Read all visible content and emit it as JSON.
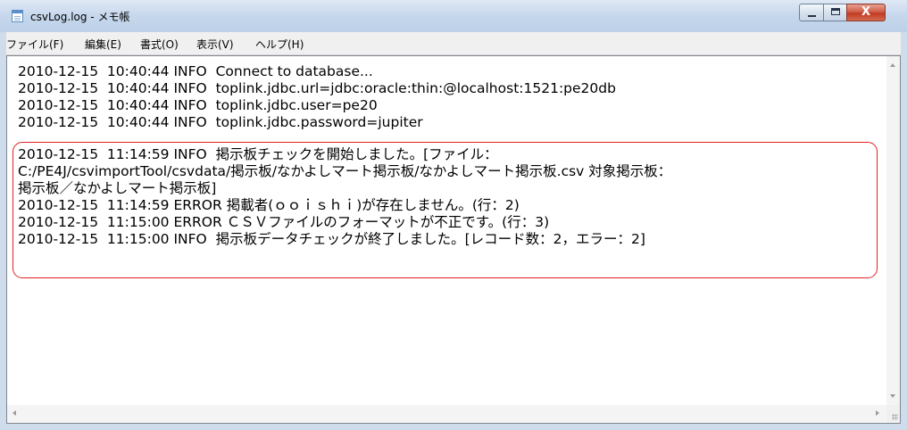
{
  "window": {
    "title": "csvLog.log - メモ帳",
    "close_glyph": "X",
    "icons": [
      "notepad-icon",
      "minimize-icon",
      "maximize-icon",
      "close-icon"
    ]
  },
  "menu": {
    "items": [
      {
        "label": "ファイル(F)"
      },
      {
        "label": "編集(E)"
      },
      {
        "label": "書式(O)"
      },
      {
        "label": "表示(V)"
      },
      {
        "label": "ヘルプ(H)"
      }
    ]
  },
  "document": {
    "lines": [
      "2010-12-15  10:40:44 INFO  Connect to database...",
      "2010-12-15  10:40:44 INFO  toplink.jdbc.url=jdbc:oracle:thin:@localhost:1521:pe20db",
      "2010-12-15  10:40:44 INFO  toplink.jdbc.user=pe20",
      "2010-12-15  10:40:44 INFO  toplink.jdbc.password=jupiter",
      "2010-12-15  11:14:59 INFO  掲示板チェックを開始しました。[ファイル：",
      "C:/PE4J/csvimportTool/csvdata/掲示板/なかよしマート掲示板/なかよしマート掲示板.csv 対象掲示板：",
      "掲示板／なかよしマート掲示板]",
      "2010-12-15  11:14:59 ERROR 掲載者(ｏｏｉｓｈｉ)が存在しません。(行：2)",
      "2010-12-15  11:15:00 ERROR ＣＳＶファイルのフォーマットが不正です。(行：3)",
      "2010-12-15  11:15:00 INFO  掲示板データチェックが終了しました。[レコード数：2，エラー：2]"
    ]
  },
  "annotation": {
    "color": "#e02020"
  }
}
